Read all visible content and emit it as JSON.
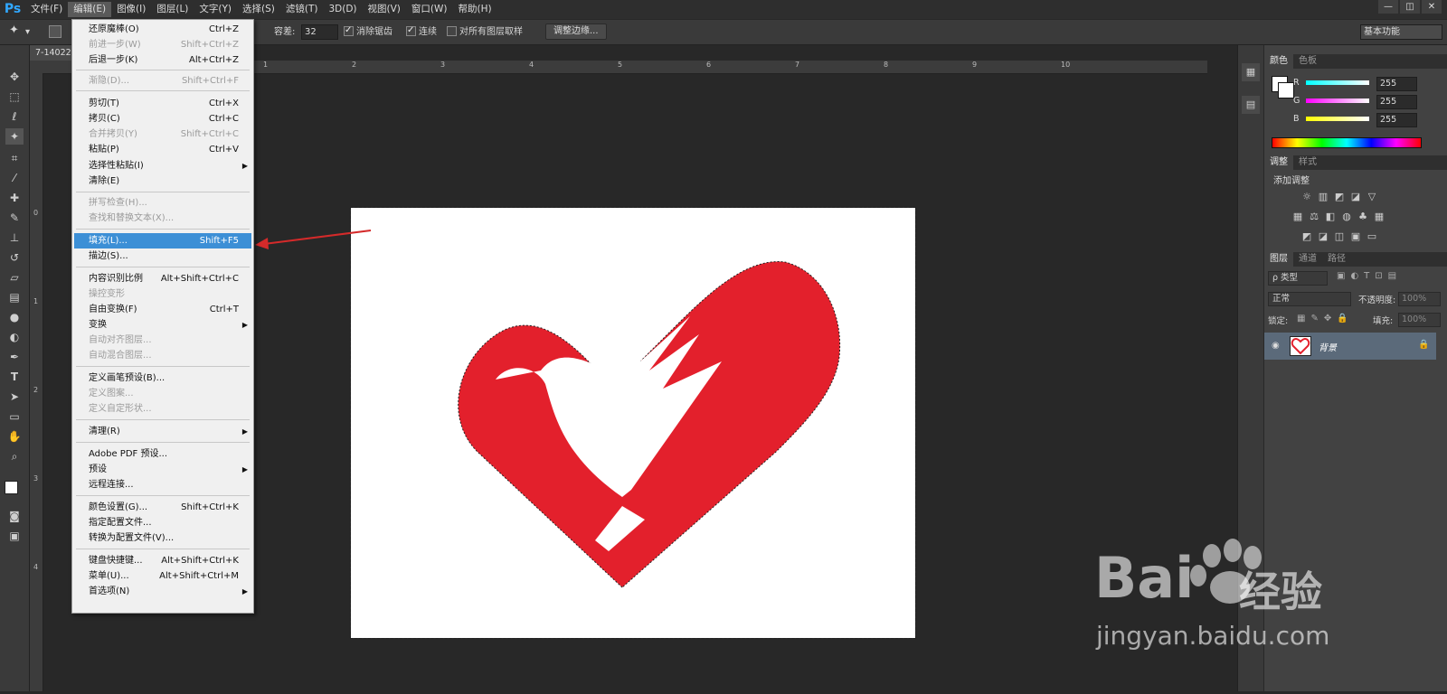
{
  "app": {
    "logo": "Ps"
  },
  "menubar": {
    "items": [
      "文件(F)",
      "编辑(E)",
      "图像(I)",
      "图层(L)",
      "文字(Y)",
      "选择(S)",
      "滤镜(T)",
      "3D(D)",
      "视图(V)",
      "窗口(W)",
      "帮助(H)"
    ],
    "window_controls": [
      "—",
      "◫",
      "✕"
    ]
  },
  "options_bar": {
    "tolerance_label": "容差:",
    "tolerance_value": "32",
    "anti_alias": "消除锯齿",
    "contiguous": "连续",
    "sample_all_layers": "对所有图层取样",
    "refine_edge": "调整边缘...",
    "workspace": "基本功能"
  },
  "document": {
    "tab_label": "7-14022"
  },
  "rulers": {
    "top": [
      "1",
      "2",
      "3",
      "4",
      "5",
      "6",
      "7",
      "8",
      "9",
      "10"
    ],
    "left": [
      "0",
      "1",
      "2",
      "3",
      "4"
    ]
  },
  "edit_menu": {
    "items": [
      {
        "label": "还原魔棒(O)",
        "shortcut": "Ctrl+Z",
        "disabled": false
      },
      {
        "label": "前进一步(W)",
        "shortcut": "Shift+Ctrl+Z",
        "disabled": true
      },
      {
        "label": "后退一步(K)",
        "shortcut": "Alt+Ctrl+Z",
        "disabled": false
      },
      {
        "label": "渐隐(D)...",
        "shortcut": "Shift+Ctrl+F",
        "disabled": true
      },
      {
        "label": "剪切(T)",
        "shortcut": "Ctrl+X",
        "disabled": false
      },
      {
        "label": "拷贝(C)",
        "shortcut": "Ctrl+C",
        "disabled": false
      },
      {
        "label": "合并拷贝(Y)",
        "shortcut": "Shift+Ctrl+C",
        "disabled": true
      },
      {
        "label": "粘贴(P)",
        "shortcut": "Ctrl+V",
        "disabled": false
      },
      {
        "label": "选择性粘贴(I)",
        "shortcut": "",
        "disabled": false,
        "submenu": true
      },
      {
        "label": "清除(E)",
        "shortcut": "",
        "disabled": false
      },
      {
        "label": "拼写检查(H)...",
        "shortcut": "",
        "disabled": true
      },
      {
        "label": "查找和替换文本(X)...",
        "shortcut": "",
        "disabled": true
      },
      {
        "label": "填充(L)...",
        "shortcut": "Shift+F5",
        "disabled": false,
        "highlighted": true
      },
      {
        "label": "描边(S)...",
        "shortcut": "",
        "disabled": false
      },
      {
        "label": "内容识别比例",
        "shortcut": "Alt+Shift+Ctrl+C",
        "disabled": false
      },
      {
        "label": "操控变形",
        "shortcut": "",
        "disabled": true
      },
      {
        "label": "自由变换(F)",
        "shortcut": "Ctrl+T",
        "disabled": false
      },
      {
        "label": "变换",
        "shortcut": "",
        "disabled": false,
        "submenu": true
      },
      {
        "label": "自动对齐图层...",
        "shortcut": "",
        "disabled": true
      },
      {
        "label": "自动混合图层...",
        "shortcut": "",
        "disabled": true
      },
      {
        "label": "定义画笔预设(B)...",
        "shortcut": "",
        "disabled": false
      },
      {
        "label": "定义图案...",
        "shortcut": "",
        "disabled": true
      },
      {
        "label": "定义自定形状...",
        "shortcut": "",
        "disabled": true
      },
      {
        "label": "清理(R)",
        "shortcut": "",
        "disabled": false,
        "submenu": true
      },
      {
        "label": "Adobe PDF 预设...",
        "shortcut": "",
        "disabled": false
      },
      {
        "label": "预设",
        "shortcut": "",
        "disabled": false,
        "submenu": true
      },
      {
        "label": "远程连接...",
        "shortcut": "",
        "disabled": false
      },
      {
        "label": "颜色设置(G)...",
        "shortcut": "Shift+Ctrl+K",
        "disabled": false
      },
      {
        "label": "指定配置文件...",
        "shortcut": "",
        "disabled": false
      },
      {
        "label": "转换为配置文件(V)...",
        "shortcut": "",
        "disabled": false
      },
      {
        "label": "键盘快捷键...",
        "shortcut": "Alt+Shift+Ctrl+K",
        "disabled": false
      },
      {
        "label": "菜单(U)...",
        "shortcut": "Alt+Shift+Ctrl+M",
        "disabled": false
      },
      {
        "label": "首选项(N)",
        "shortcut": "",
        "disabled": false,
        "submenu": true
      }
    ]
  },
  "color_panel": {
    "tabs": [
      "颜色",
      "色板"
    ],
    "channels": [
      {
        "name": "R",
        "value": "255"
      },
      {
        "name": "G",
        "value": "255"
      },
      {
        "name": "B",
        "value": "255"
      }
    ]
  },
  "adjustments_panel": {
    "tabs": [
      "调整",
      "样式"
    ],
    "title": "添加调整"
  },
  "layers_panel": {
    "tabs": [
      "图层",
      "通道",
      "路径"
    ],
    "filter_kind": "ρ 类型",
    "blend_mode": "正常",
    "opacity_label": "不透明度:",
    "opacity_value": "100%",
    "lock_label": "锁定:",
    "fill_label": "填充:",
    "fill_value": "100%",
    "layer_name": "背景"
  },
  "colors": {
    "logo_red": "#e3202c",
    "menu_highlight": "#3c8fd6",
    "arrow": "#d42a2a"
  },
  "watermark": {
    "brand": "Bai",
    "brand2": "经验",
    "url": "jingyan.baidu.com"
  }
}
